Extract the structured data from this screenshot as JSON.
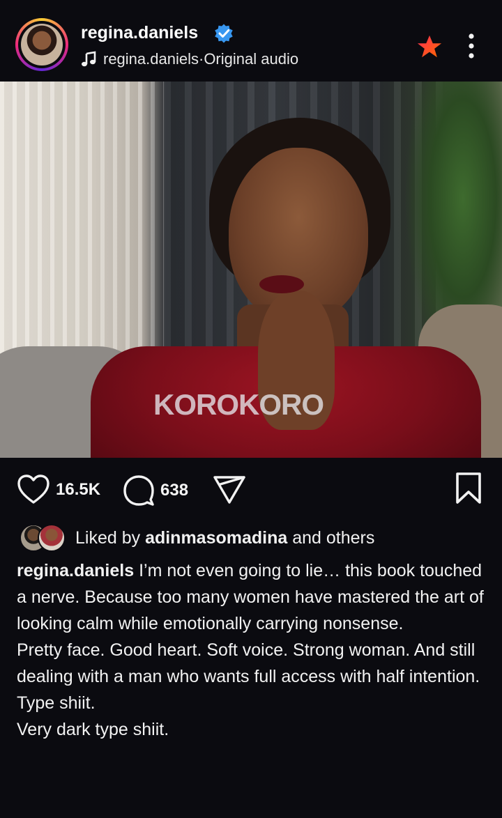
{
  "post_header": {
    "username": "regina.daniels",
    "audio_user": "regina.daniels",
    "audio_separator": " · ",
    "audio_label": "Original audio",
    "verified": true
  },
  "icons": {
    "verified": "verified-badge-icon",
    "music": "music-note-icon",
    "favorite": "star-icon",
    "more": "more-vertical-icon",
    "sound": "speaker-icon",
    "like": "heart-icon",
    "comment": "comment-icon",
    "share": "send-icon",
    "save": "bookmark-icon"
  },
  "media": {
    "watermark": "KOROKORO"
  },
  "actions": {
    "likes": "16.5K",
    "comments": "638"
  },
  "liked_by": {
    "prefix": "Liked by ",
    "user": "adinmasomadina",
    "suffix": " and others"
  },
  "caption": {
    "user": "regina.daniels",
    "first_line": " I’m not even going to lie… this book touched a nerve. Because too many women have mastered the art of looking calm while emotionally carrying nonsense.",
    "lines": [
      "Pretty face. Good heart. Soft voice. Strong woman. And still dealing with a man who wants full access with half intention.",
      "Type shiit.",
      "Very dark type shiit."
    ]
  },
  "colors": {
    "background": "#0b0b10",
    "verified": "#3897f0",
    "star": "#ff3b30",
    "watermark_accent": "#1e5d8c"
  }
}
